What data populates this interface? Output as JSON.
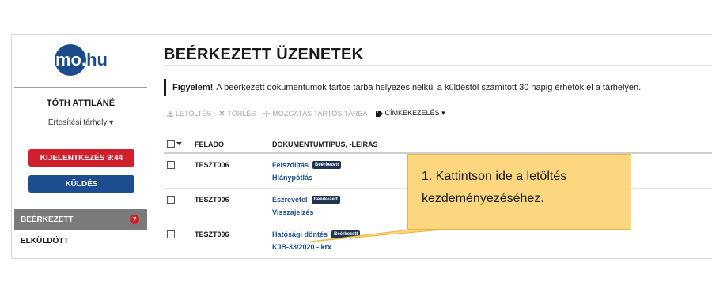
{
  "logo": {
    "text_a": "mo.",
    "text_b": "hu"
  },
  "sidebar": {
    "user_name": "TÓTH ATTILÁNÉ",
    "storage_label": "Értesítési tárhely ▾",
    "logout_button": "KIJELENTKEZÉS 9:44",
    "send_button": "KÜLDÉS",
    "nav": [
      {
        "label": "BEÉRKEZETT",
        "badge": "7"
      },
      {
        "label": "ELKÜLDÖTT"
      }
    ]
  },
  "main": {
    "title": "BEÉRKEZETT ÜZENETEK",
    "notice_strong": "Figyelem!",
    "notice_text": "A beérkezett dokumentumok tartós tárba helyezés nélkül a küldéstől számított 30 napig érhetők el a tárhelyen.",
    "toolbar": [
      "LETÖLTÉS",
      "TÖRLÉS",
      "MOZGATÁS TARTÓS TÁRBA",
      "CÍMKEKEZELÉS ▾"
    ],
    "table_headers": {
      "sender": "FELADÓ",
      "doctype": "DOKUMENTUMTÍPUS, -LEÍRÁS"
    },
    "rows": [
      {
        "sender": "TESZT006",
        "doc": "Felszólítás",
        "tag": "Beérkezett",
        "sub": "Hiánypótlás"
      },
      {
        "sender": "TESZT006",
        "doc": "Észrevétel",
        "tag": "Beérkezett",
        "sub": "Visszajelzés"
      },
      {
        "sender": "TESZT006",
        "doc": "Hatósági döntés",
        "tag": "Beérkezett",
        "sub": "KJB-33/2020 - krx"
      }
    ]
  },
  "callout": {
    "text": "1. Kattintson ide a letöltés kezdeményezéséhez."
  },
  "colors": {
    "brand_blue": "#1b4d90",
    "logout_red": "#d0202e",
    "callout_yellow": "#fcd77f",
    "nav_active": "#7b7b7b"
  }
}
